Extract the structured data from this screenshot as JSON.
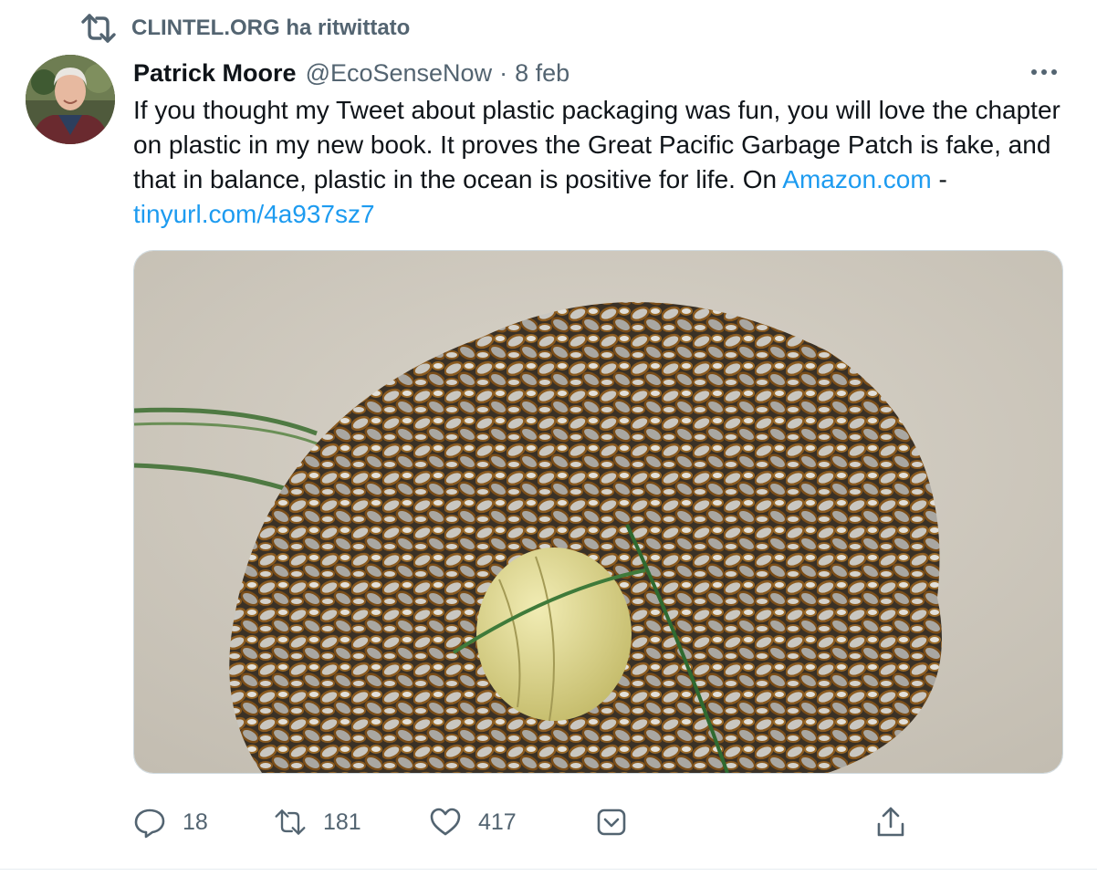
{
  "retweet": {
    "label": "CLINTEL.ORG ha ritwittato"
  },
  "author": {
    "name": "Patrick Moore",
    "handle": "@EcoSenseNow",
    "separator": "·",
    "date": "8 feb"
  },
  "tweet": {
    "text_main": "If you thought my Tweet about plastic packaging was fun, you will love the chapter on plastic in my new book. It proves the Great Pacific Garbage Patch is fake, and that in balance, plastic in the ocean is positive for life. On ",
    "link1": "Amazon.com",
    "link_separator": " - ",
    "link2": "tinyurl.com/4a937sz7"
  },
  "actions": {
    "replies": "18",
    "retweets": "181",
    "likes": "417"
  },
  "icons": [
    "retweet-icon",
    "more-icon",
    "reply-icon",
    "like-icon",
    "bookmark-icon",
    "share-icon"
  ],
  "colors": {
    "link": "#1d9bf0",
    "secondary_text": "#536471",
    "primary_text": "#0f1419"
  }
}
